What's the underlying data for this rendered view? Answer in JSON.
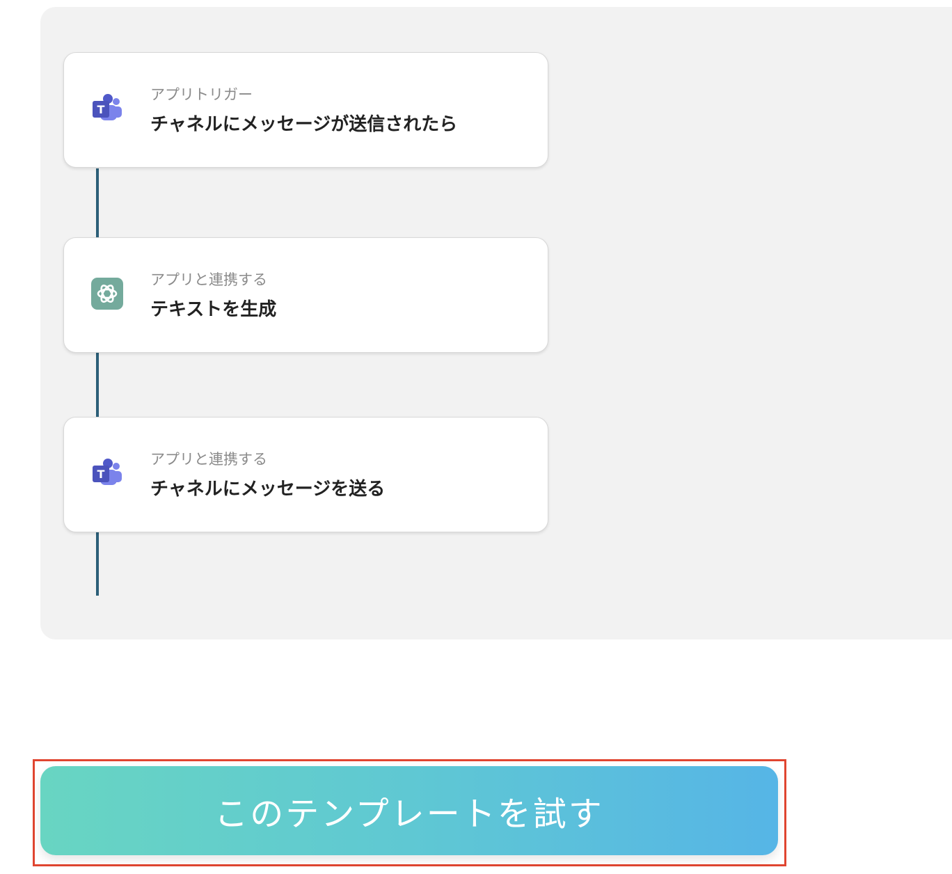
{
  "flow": {
    "steps": [
      {
        "icon": "microsoft-teams-icon",
        "subtitle": "アプリトリガー",
        "title": "チャネルにメッセージが送信されたら"
      },
      {
        "icon": "chatgpt-icon",
        "subtitle": "アプリと連携する",
        "title": "テキストを生成"
      },
      {
        "icon": "microsoft-teams-icon",
        "subtitle": "アプリと連携する",
        "title": "チャネルにメッセージを送る"
      }
    ]
  },
  "cta": {
    "label": "このテンプレートを試す"
  },
  "colors": {
    "connector": "#2c5f78",
    "panel": "#f2f2f2",
    "highlight_border": "#e04530",
    "cta_gradient_start": "#68d5c2",
    "cta_gradient_end": "#56b5e6"
  }
}
